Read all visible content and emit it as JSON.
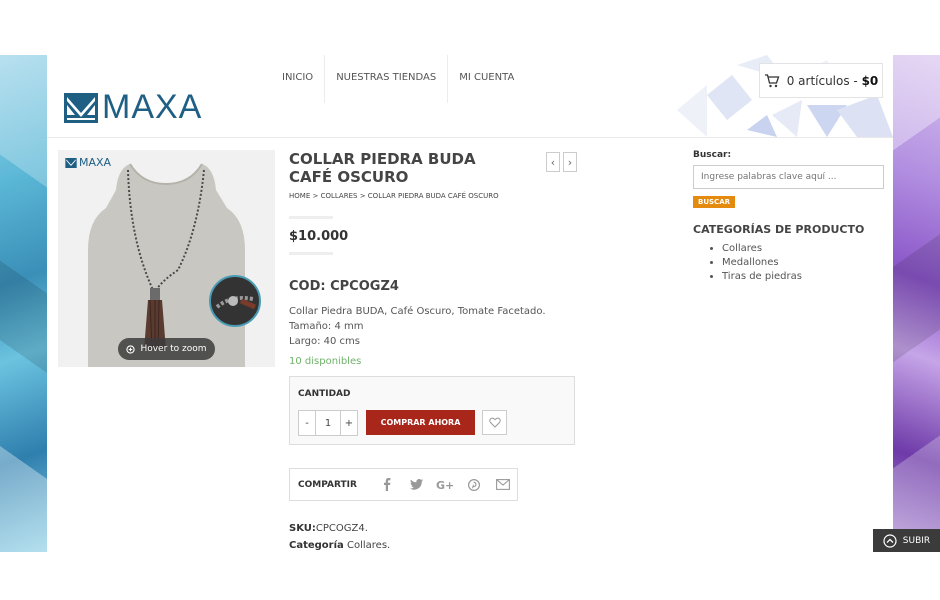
{
  "header": {
    "logo_text": "MAXA",
    "nav": [
      "INICIO",
      "NUESTRAS TIENDAS",
      "MI CUENTA"
    ],
    "cart": {
      "text": "0 artículos - ",
      "amount": "$0",
      "icon": "cart-icon"
    }
  },
  "product": {
    "title": "COLLAR PIEDRA BUDA CAFÉ OSCURO",
    "breadcrumb": [
      "HOME",
      "COLLARES",
      "COLLAR PIEDRA BUDA CAFÉ OSCURO"
    ],
    "breadcrumb_sep": " > ",
    "price": "$10.000",
    "code": "COD: CPCOGZ4",
    "description": [
      "Collar Piedra BUDA, Café Oscuro, Tomate Facetado.",
      "Tamaño: 4 mm",
      "Largo: 40 cms"
    ],
    "stock": "10 disponibles",
    "gallery_logo": "MAXA",
    "zoom_label": "Hover to zoom",
    "quantity_label": "CANTIDAD",
    "quantity": "1",
    "minus": "-",
    "plus": "+",
    "buy_label": "COMPRAR AHORA",
    "share_label": "COMPARTIR",
    "sku_label": "SKU:",
    "sku": "CPCOGZ4.",
    "category_label": "Categoría",
    "category": "Collares.",
    "prev_arrow": "‹",
    "next_arrow": "›"
  },
  "sidebar": {
    "search_label": "Buscar:",
    "search_placeholder": "Ingrese palabras clave aquí ...",
    "search_button": "BUSCAR",
    "categories_title": "CATEGORÍAS DE PRODUCTO",
    "categories": [
      "Collares",
      "Medallones",
      "Tiras de piedras"
    ]
  },
  "footer": {
    "subir": "SUBIR"
  },
  "colors": {
    "brand": "#1f5f84",
    "buy": "#a9261b",
    "search_button": "#e48a0e",
    "stock": "#6fb26a"
  }
}
